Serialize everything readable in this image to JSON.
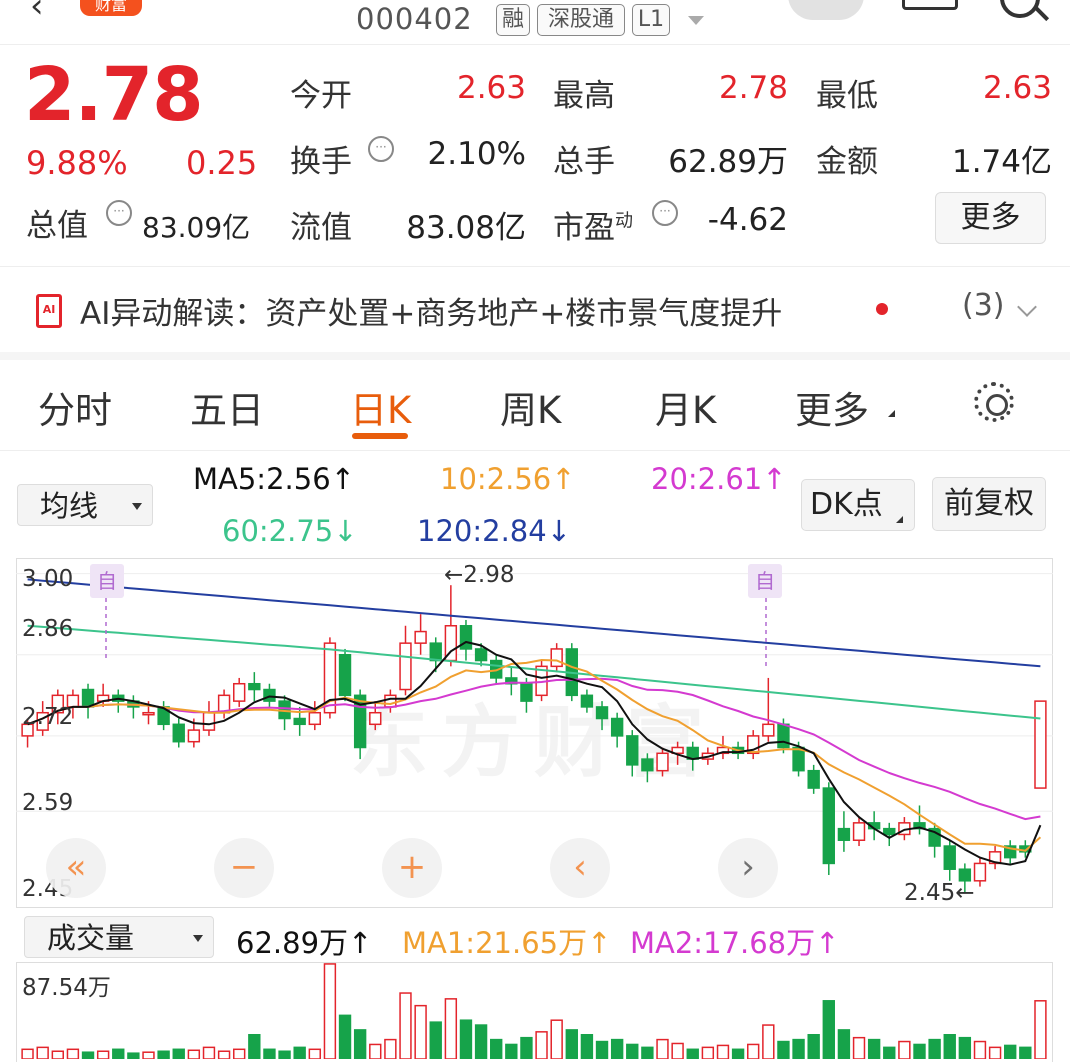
{
  "header": {
    "stock_code": "000402",
    "tags": [
      "融",
      "深股通",
      "L1"
    ],
    "brand_badge": "财富"
  },
  "quote": {
    "price": "2.78",
    "change_pct": "9.88%",
    "change_amt": "0.25",
    "total_value_label": "总值",
    "total_value": "83.09亿",
    "fields": [
      {
        "label": "今开",
        "value": "2.63"
      },
      {
        "label": "最高",
        "value": "2.78"
      },
      {
        "label": "最低",
        "value": "2.63"
      },
      {
        "label": "换手",
        "value": "2.10%"
      },
      {
        "label": "总手",
        "value": "62.89万"
      },
      {
        "label": "金额",
        "value": "1.74亿"
      },
      {
        "label": "流值",
        "value": "83.08亿"
      },
      {
        "label": "市盈",
        "sup": "动",
        "value": "-4.62"
      }
    ],
    "more_label": "更多",
    "colors": {
      "up": "#e3242b",
      "down": "#16a34a"
    }
  },
  "ai_bar": {
    "icon_text": "AI",
    "text": "AI异动解读：资产处置+商务地产+楼市景气度提升",
    "count": "(3)"
  },
  "tabs": [
    "分时",
    "五日",
    "日K",
    "周K",
    "月K",
    "更多"
  ],
  "active_tab": "日K",
  "ma_row": {
    "select_label": "均线",
    "ma5": "MA5:2.56↑",
    "ma10": "10:2.56↑",
    "ma20": "20:2.61↑",
    "ma60": "60:2.75↓",
    "ma120": "120:2.84↓",
    "dk_button": "DK点",
    "fq_button": "前复权",
    "colors": {
      "ma5": "#111111",
      "ma10": "#f0a030",
      "ma20": "#d43ad0",
      "ma60": "#3cc48c",
      "ma120": "#233ea0"
    }
  },
  "chart": {
    "y_ticks": [
      "3.00",
      "2.86",
      "2.72",
      "2.59",
      "2.45"
    ],
    "high_marker": "←2.98",
    "low_marker": "2.45←",
    "marker_zi": "自",
    "watermark": "东方财富",
    "zoom_buttons": [
      "«",
      "−",
      "+",
      "‹",
      "›"
    ]
  },
  "volume": {
    "select_label": "成交量",
    "vol": "62.89万↑",
    "ma1": "MA1:21.65万↑",
    "ma2": "MA2:17.68万↑",
    "y_top": "87.54万"
  },
  "chart_data": {
    "type": "candlestick",
    "ylim": [
      2.43,
      3.02
    ],
    "candles": [
      [
        2.72,
        2.74,
        2.75,
        2.7
      ],
      [
        2.73,
        2.76,
        2.78,
        2.72
      ],
      [
        2.76,
        2.79,
        2.8,
        2.74
      ],
      [
        2.77,
        2.79,
        2.8,
        2.75
      ],
      [
        2.8,
        2.77,
        2.81,
        2.75
      ],
      [
        2.78,
        2.79,
        2.81,
        2.77
      ],
      [
        2.79,
        2.78,
        2.8,
        2.76
      ],
      [
        2.78,
        2.77,
        2.79,
        2.75
      ],
      [
        2.76,
        2.76,
        2.78,
        2.74
      ],
      [
        2.77,
        2.74,
        2.78,
        2.73
      ],
      [
        2.74,
        2.71,
        2.75,
        2.7
      ],
      [
        2.71,
        2.73,
        2.75,
        2.7
      ],
      [
        2.73,
        2.76,
        2.78,
        2.72
      ],
      [
        2.76,
        2.79,
        2.8,
        2.75
      ],
      [
        2.78,
        2.81,
        2.82,
        2.77
      ],
      [
        2.81,
        2.8,
        2.83,
        2.78
      ],
      [
        2.8,
        2.78,
        2.81,
        2.77
      ],
      [
        2.78,
        2.75,
        2.79,
        2.73
      ],
      [
        2.75,
        2.74,
        2.77,
        2.72
      ],
      [
        2.74,
        2.76,
        2.78,
        2.73
      ],
      [
        2.76,
        2.88,
        2.89,
        2.75
      ],
      [
        2.86,
        2.79,
        2.87,
        2.78
      ],
      [
        2.79,
        2.7,
        2.8,
        2.68
      ],
      [
        2.74,
        2.76,
        2.78,
        2.73
      ],
      [
        2.77,
        2.79,
        2.8,
        2.76
      ],
      [
        2.8,
        2.88,
        2.91,
        2.79
      ],
      [
        2.88,
        2.9,
        2.93,
        2.86
      ],
      [
        2.88,
        2.85,
        2.89,
        2.83
      ],
      [
        2.85,
        2.91,
        2.98,
        2.84
      ],
      [
        2.91,
        2.87,
        2.92,
        2.85
      ],
      [
        2.87,
        2.85,
        2.88,
        2.84
      ],
      [
        2.85,
        2.82,
        2.86,
        2.81
      ],
      [
        2.82,
        2.81,
        2.84,
        2.79
      ],
      [
        2.81,
        2.78,
        2.82,
        2.76
      ],
      [
        2.79,
        2.84,
        2.85,
        2.78
      ],
      [
        2.84,
        2.87,
        2.88,
        2.83
      ],
      [
        2.87,
        2.79,
        2.88,
        2.78
      ],
      [
        2.79,
        2.77,
        2.8,
        2.76
      ],
      [
        2.77,
        2.75,
        2.78,
        2.73
      ],
      [
        2.75,
        2.72,
        2.76,
        2.7
      ],
      [
        2.72,
        2.67,
        2.73,
        2.65
      ],
      [
        2.68,
        2.66,
        2.69,
        2.64
      ],
      [
        2.66,
        2.69,
        2.7,
        2.65
      ],
      [
        2.69,
        2.7,
        2.71,
        2.67
      ],
      [
        2.7,
        2.68,
        2.71,
        2.66
      ],
      [
        2.68,
        2.69,
        2.7,
        2.67
      ],
      [
        2.69,
        2.7,
        2.72,
        2.68
      ],
      [
        2.7,
        2.69,
        2.71,
        2.68
      ],
      [
        2.69,
        2.72,
        2.73,
        2.68
      ],
      [
        2.72,
        2.74,
        2.82,
        2.71
      ],
      [
        2.74,
        2.7,
        2.75,
        2.69
      ],
      [
        2.7,
        2.66,
        2.71,
        2.65
      ],
      [
        2.66,
        2.63,
        2.67,
        2.62
      ],
      [
        2.63,
        2.5,
        2.64,
        2.48
      ],
      [
        2.56,
        2.54,
        2.59,
        2.52
      ],
      [
        2.54,
        2.57,
        2.58,
        2.53
      ],
      [
        2.57,
        2.56,
        2.59,
        2.54
      ],
      [
        2.56,
        2.55,
        2.57,
        2.53
      ],
      [
        2.55,
        2.57,
        2.58,
        2.54
      ],
      [
        2.57,
        2.56,
        2.6,
        2.55
      ],
      [
        2.56,
        2.53,
        2.57,
        2.51
      ],
      [
        2.53,
        2.49,
        2.54,
        2.47
      ],
      [
        2.49,
        2.47,
        2.5,
        2.45
      ],
      [
        2.47,
        2.5,
        2.51,
        2.46
      ],
      [
        2.5,
        2.52,
        2.53,
        2.49
      ],
      [
        2.53,
        2.51,
        2.54,
        2.5
      ],
      [
        2.53,
        2.52,
        2.54,
        2.51
      ],
      [
        2.63,
        2.78,
        2.78,
        2.63
      ]
    ]
  }
}
